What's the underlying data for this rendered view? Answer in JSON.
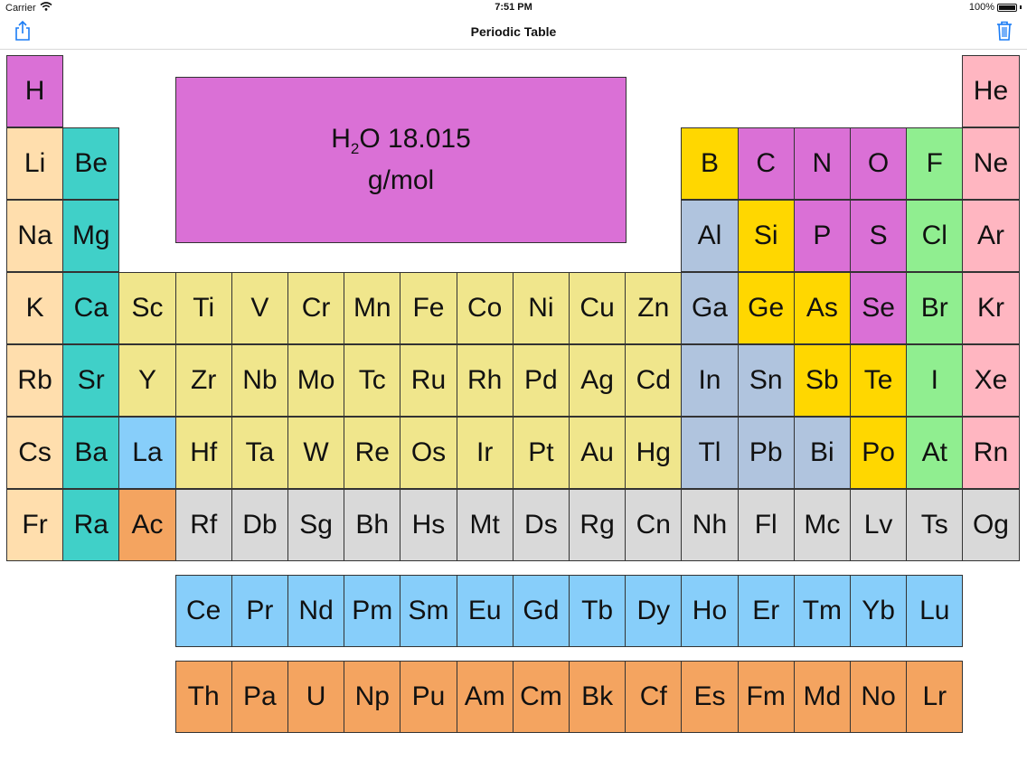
{
  "status_bar": {
    "carrier": "Carrier",
    "time": "7:51 PM",
    "battery": "100%",
    "battery_level": 1.0
  },
  "nav": {
    "title": "Periodic Table"
  },
  "icons": {
    "share": "share-icon",
    "trash": "trash-icon",
    "wifi": "wifi-icon",
    "battery": "battery-icon"
  },
  "display": {
    "formula_base": "H",
    "formula_sub": "2",
    "formula_rest": "O 18.015",
    "unit": "g/mol"
  },
  "colors": {
    "nonmetal": "#da70d6",
    "noble": "#ffb6c1",
    "alkali": "#ffdead",
    "alkaline": "#40d0c8",
    "metalloid": "#ffd700",
    "halogen": "#90ee90",
    "post_transition": "#b0c4de",
    "transition": "#f0e68c",
    "lanthanide": "#87cefa",
    "actinide": "#f4a460",
    "unknown": "#d9d9d9"
  },
  "elements": [
    {
      "s": "H",
      "r": 1,
      "c": 1,
      "k": "nonmetal"
    },
    {
      "s": "He",
      "r": 1,
      "c": 18,
      "k": "noble"
    },
    {
      "s": "Li",
      "r": 2,
      "c": 1,
      "k": "alkali"
    },
    {
      "s": "Be",
      "r": 2,
      "c": 2,
      "k": "alkaline"
    },
    {
      "s": "B",
      "r": 2,
      "c": 13,
      "k": "metalloid"
    },
    {
      "s": "C",
      "r": 2,
      "c": 14,
      "k": "nonmetal"
    },
    {
      "s": "N",
      "r": 2,
      "c": 15,
      "k": "nonmetal"
    },
    {
      "s": "O",
      "r": 2,
      "c": 16,
      "k": "nonmetal"
    },
    {
      "s": "F",
      "r": 2,
      "c": 17,
      "k": "halogen"
    },
    {
      "s": "Ne",
      "r": 2,
      "c": 18,
      "k": "noble"
    },
    {
      "s": "Na",
      "r": 3,
      "c": 1,
      "k": "alkali"
    },
    {
      "s": "Mg",
      "r": 3,
      "c": 2,
      "k": "alkaline"
    },
    {
      "s": "Al",
      "r": 3,
      "c": 13,
      "k": "post_transition"
    },
    {
      "s": "Si",
      "r": 3,
      "c": 14,
      "k": "metalloid"
    },
    {
      "s": "P",
      "r": 3,
      "c": 15,
      "k": "nonmetal"
    },
    {
      "s": "S",
      "r": 3,
      "c": 16,
      "k": "nonmetal"
    },
    {
      "s": "Cl",
      "r": 3,
      "c": 17,
      "k": "halogen"
    },
    {
      "s": "Ar",
      "r": 3,
      "c": 18,
      "k": "noble"
    },
    {
      "s": "K",
      "r": 4,
      "c": 1,
      "k": "alkali"
    },
    {
      "s": "Ca",
      "r": 4,
      "c": 2,
      "k": "alkaline"
    },
    {
      "s": "Sc",
      "r": 4,
      "c": 3,
      "k": "transition"
    },
    {
      "s": "Ti",
      "r": 4,
      "c": 4,
      "k": "transition"
    },
    {
      "s": "V",
      "r": 4,
      "c": 5,
      "k": "transition"
    },
    {
      "s": "Cr",
      "r": 4,
      "c": 6,
      "k": "transition"
    },
    {
      "s": "Mn",
      "r": 4,
      "c": 7,
      "k": "transition"
    },
    {
      "s": "Fe",
      "r": 4,
      "c": 8,
      "k": "transition"
    },
    {
      "s": "Co",
      "r": 4,
      "c": 9,
      "k": "transition"
    },
    {
      "s": "Ni",
      "r": 4,
      "c": 10,
      "k": "transition"
    },
    {
      "s": "Cu",
      "r": 4,
      "c": 11,
      "k": "transition"
    },
    {
      "s": "Zn",
      "r": 4,
      "c": 12,
      "k": "transition"
    },
    {
      "s": "Ga",
      "r": 4,
      "c": 13,
      "k": "post_transition"
    },
    {
      "s": "Ge",
      "r": 4,
      "c": 14,
      "k": "metalloid"
    },
    {
      "s": "As",
      "r": 4,
      "c": 15,
      "k": "metalloid"
    },
    {
      "s": "Se",
      "r": 4,
      "c": 16,
      "k": "nonmetal"
    },
    {
      "s": "Br",
      "r": 4,
      "c": 17,
      "k": "halogen"
    },
    {
      "s": "Kr",
      "r": 4,
      "c": 18,
      "k": "noble"
    },
    {
      "s": "Rb",
      "r": 5,
      "c": 1,
      "k": "alkali"
    },
    {
      "s": "Sr",
      "r": 5,
      "c": 2,
      "k": "alkaline"
    },
    {
      "s": "Y",
      "r": 5,
      "c": 3,
      "k": "transition"
    },
    {
      "s": "Zr",
      "r": 5,
      "c": 4,
      "k": "transition"
    },
    {
      "s": "Nb",
      "r": 5,
      "c": 5,
      "k": "transition"
    },
    {
      "s": "Mo",
      "r": 5,
      "c": 6,
      "k": "transition"
    },
    {
      "s": "Tc",
      "r": 5,
      "c": 7,
      "k": "transition"
    },
    {
      "s": "Ru",
      "r": 5,
      "c": 8,
      "k": "transition"
    },
    {
      "s": "Rh",
      "r": 5,
      "c": 9,
      "k": "transition"
    },
    {
      "s": "Pd",
      "r": 5,
      "c": 10,
      "k": "transition"
    },
    {
      "s": "Ag",
      "r": 5,
      "c": 11,
      "k": "transition"
    },
    {
      "s": "Cd",
      "r": 5,
      "c": 12,
      "k": "transition"
    },
    {
      "s": "In",
      "r": 5,
      "c": 13,
      "k": "post_transition"
    },
    {
      "s": "Sn",
      "r": 5,
      "c": 14,
      "k": "post_transition"
    },
    {
      "s": "Sb",
      "r": 5,
      "c": 15,
      "k": "metalloid"
    },
    {
      "s": "Te",
      "r": 5,
      "c": 16,
      "k": "metalloid"
    },
    {
      "s": "I",
      "r": 5,
      "c": 17,
      "k": "halogen"
    },
    {
      "s": "Xe",
      "r": 5,
      "c": 18,
      "k": "noble"
    },
    {
      "s": "Cs",
      "r": 6,
      "c": 1,
      "k": "alkali"
    },
    {
      "s": "Ba",
      "r": 6,
      "c": 2,
      "k": "alkaline"
    },
    {
      "s": "La",
      "r": 6,
      "c": 3,
      "k": "lanthanide"
    },
    {
      "s": "Hf",
      "r": 6,
      "c": 4,
      "k": "transition"
    },
    {
      "s": "Ta",
      "r": 6,
      "c": 5,
      "k": "transition"
    },
    {
      "s": "W",
      "r": 6,
      "c": 6,
      "k": "transition"
    },
    {
      "s": "Re",
      "r": 6,
      "c": 7,
      "k": "transition"
    },
    {
      "s": "Os",
      "r": 6,
      "c": 8,
      "k": "transition"
    },
    {
      "s": "Ir",
      "r": 6,
      "c": 9,
      "k": "transition"
    },
    {
      "s": "Pt",
      "r": 6,
      "c": 10,
      "k": "transition"
    },
    {
      "s": "Au",
      "r": 6,
      "c": 11,
      "k": "transition"
    },
    {
      "s": "Hg",
      "r": 6,
      "c": 12,
      "k": "transition"
    },
    {
      "s": "Tl",
      "r": 6,
      "c": 13,
      "k": "post_transition"
    },
    {
      "s": "Pb",
      "r": 6,
      "c": 14,
      "k": "post_transition"
    },
    {
      "s": "Bi",
      "r": 6,
      "c": 15,
      "k": "post_transition"
    },
    {
      "s": "Po",
      "r": 6,
      "c": 16,
      "k": "metalloid"
    },
    {
      "s": "At",
      "r": 6,
      "c": 17,
      "k": "halogen"
    },
    {
      "s": "Rn",
      "r": 6,
      "c": 18,
      "k": "noble"
    },
    {
      "s": "Fr",
      "r": 7,
      "c": 1,
      "k": "alkali"
    },
    {
      "s": "Ra",
      "r": 7,
      "c": 2,
      "k": "alkaline"
    },
    {
      "s": "Ac",
      "r": 7,
      "c": 3,
      "k": "actinide"
    },
    {
      "s": "Rf",
      "r": 7,
      "c": 4,
      "k": "unknown"
    },
    {
      "s": "Db",
      "r": 7,
      "c": 5,
      "k": "unknown"
    },
    {
      "s": "Sg",
      "r": 7,
      "c": 6,
      "k": "unknown"
    },
    {
      "s": "Bh",
      "r": 7,
      "c": 7,
      "k": "unknown"
    },
    {
      "s": "Hs",
      "r": 7,
      "c": 8,
      "k": "unknown"
    },
    {
      "s": "Mt",
      "r": 7,
      "c": 9,
      "k": "unknown"
    },
    {
      "s": "Ds",
      "r": 7,
      "c": 10,
      "k": "unknown"
    },
    {
      "s": "Rg",
      "r": 7,
      "c": 11,
      "k": "unknown"
    },
    {
      "s": "Cn",
      "r": 7,
      "c": 12,
      "k": "unknown"
    },
    {
      "s": "Nh",
      "r": 7,
      "c": 13,
      "k": "unknown"
    },
    {
      "s": "Fl",
      "r": 7,
      "c": 14,
      "k": "unknown"
    },
    {
      "s": "Mc",
      "r": 7,
      "c": 15,
      "k": "unknown"
    },
    {
      "s": "Lv",
      "r": 7,
      "c": 16,
      "k": "unknown"
    },
    {
      "s": "Ts",
      "r": 7,
      "c": 17,
      "k": "unknown"
    },
    {
      "s": "Og",
      "r": 7,
      "c": 18,
      "k": "unknown"
    },
    {
      "s": "Ce",
      "r": 8,
      "c": 4,
      "k": "lanthanide"
    },
    {
      "s": "Pr",
      "r": 8,
      "c": 5,
      "k": "lanthanide"
    },
    {
      "s": "Nd",
      "r": 8,
      "c": 6,
      "k": "lanthanide"
    },
    {
      "s": "Pm",
      "r": 8,
      "c": 7,
      "k": "lanthanide"
    },
    {
      "s": "Sm",
      "r": 8,
      "c": 8,
      "k": "lanthanide"
    },
    {
      "s": "Eu",
      "r": 8,
      "c": 9,
      "k": "lanthanide"
    },
    {
      "s": "Gd",
      "r": 8,
      "c": 10,
      "k": "lanthanide"
    },
    {
      "s": "Tb",
      "r": 8,
      "c": 11,
      "k": "lanthanide"
    },
    {
      "s": "Dy",
      "r": 8,
      "c": 12,
      "k": "lanthanide"
    },
    {
      "s": "Ho",
      "r": 8,
      "c": 13,
      "k": "lanthanide"
    },
    {
      "s": "Er",
      "r": 8,
      "c": 14,
      "k": "lanthanide"
    },
    {
      "s": "Tm",
      "r": 8,
      "c": 15,
      "k": "lanthanide"
    },
    {
      "s": "Yb",
      "r": 8,
      "c": 16,
      "k": "lanthanide"
    },
    {
      "s": "Lu",
      "r": 8,
      "c": 17,
      "k": "lanthanide"
    },
    {
      "s": "Th",
      "r": 9,
      "c": 4,
      "k": "actinide"
    },
    {
      "s": "Pa",
      "r": 9,
      "c": 5,
      "k": "actinide"
    },
    {
      "s": "U",
      "r": 9,
      "c": 6,
      "k": "actinide"
    },
    {
      "s": "Np",
      "r": 9,
      "c": 7,
      "k": "actinide"
    },
    {
      "s": "Pu",
      "r": 9,
      "c": 8,
      "k": "actinide"
    },
    {
      "s": "Am",
      "r": 9,
      "c": 9,
      "k": "actinide"
    },
    {
      "s": "Cm",
      "r": 9,
      "c": 10,
      "k": "actinide"
    },
    {
      "s": "Bk",
      "r": 9,
      "c": 11,
      "k": "actinide"
    },
    {
      "s": "Cf",
      "r": 9,
      "c": 12,
      "k": "actinide"
    },
    {
      "s": "Es",
      "r": 9,
      "c": 13,
      "k": "actinide"
    },
    {
      "s": "Fm",
      "r": 9,
      "c": 14,
      "k": "actinide"
    },
    {
      "s": "Md",
      "r": 9,
      "c": 15,
      "k": "actinide"
    },
    {
      "s": "No",
      "r": 9,
      "c": 16,
      "k": "actinide"
    },
    {
      "s": "Lr",
      "r": 9,
      "c": 17,
      "k": "actinide"
    }
  ]
}
